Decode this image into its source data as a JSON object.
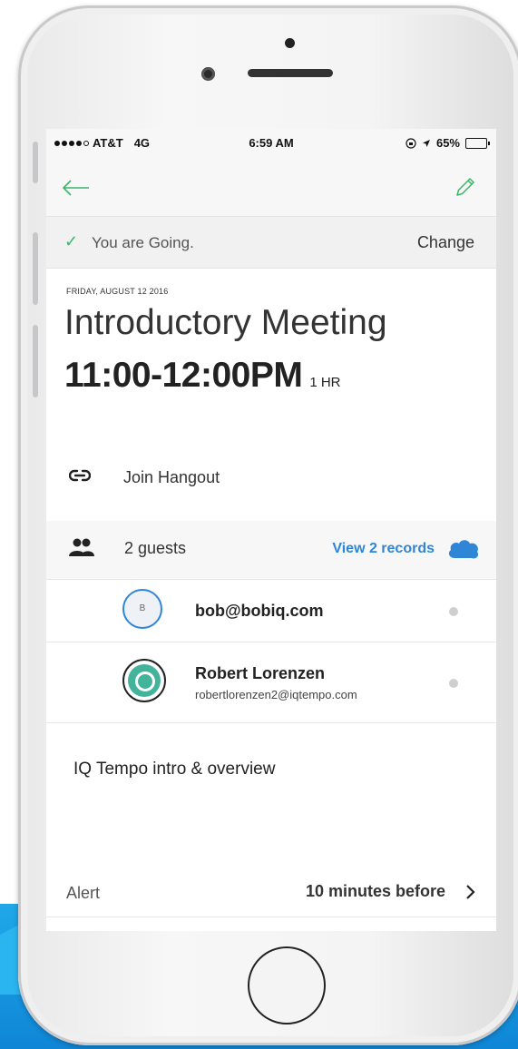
{
  "status_bar": {
    "carrier": "AT&T",
    "network": "4G",
    "time": "6:59 AM",
    "battery": "65%"
  },
  "rsvp": {
    "status_text": "You are Going.",
    "change_label": "Change"
  },
  "event": {
    "date": "FRIDAY, AUGUST 12 2016",
    "title": "Introductory Meeting",
    "time_range": "11:00-12:00PM",
    "duration": "1 HR",
    "hangout_label": "Join Hangout",
    "guests_label": "2 guests",
    "view_records_label": "View 2 records",
    "description": "IQ Tempo intro & overview"
  },
  "guests": [
    {
      "initial": "B",
      "email": "bob@bobiq.com"
    },
    {
      "name": "Robert Lorenzen",
      "email": "robertlorenzen2@iqtempo.com"
    }
  ],
  "alert": {
    "label": "Alert",
    "value": "10 minutes before"
  },
  "colors": {
    "accent_green": "#3bb56a",
    "link_blue": "#2f86d6",
    "avatar_teal": "#43b39b"
  }
}
